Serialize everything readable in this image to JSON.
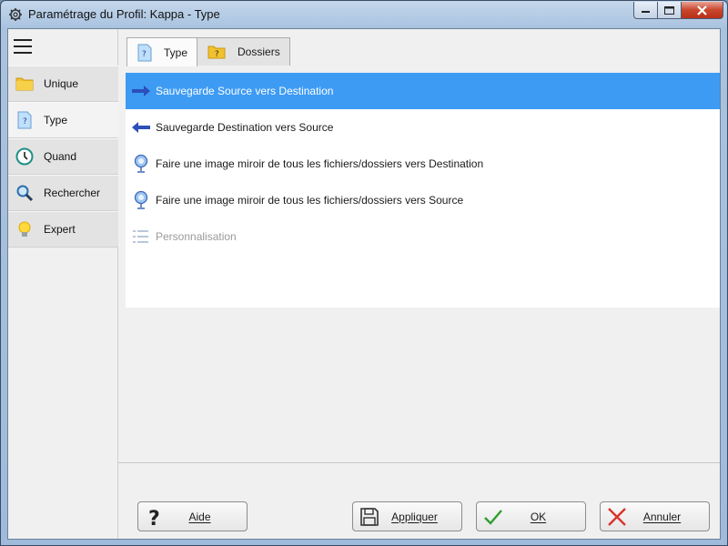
{
  "window": {
    "title": "Paramétrage du Profil: Kappa - Type",
    "controls": {
      "minimize": "▭",
      "maximize": "◻",
      "close": "✕"
    }
  },
  "sidebar": {
    "items": [
      {
        "label": "Unique",
        "icon": "folder-icon",
        "active": false
      },
      {
        "label": "Type",
        "icon": "question-file-icon",
        "active": true
      },
      {
        "label": "Quand",
        "icon": "clock-icon",
        "active": false
      },
      {
        "label": "Rechercher",
        "icon": "magnifier-icon",
        "active": false
      },
      {
        "label": "Expert",
        "icon": "lightbulb-icon",
        "active": false
      }
    ]
  },
  "tabs": [
    {
      "label": "Type",
      "icon": "question-file-icon",
      "active": true
    },
    {
      "label": "Dossiers",
      "icon": "question-folder-icon",
      "active": false
    }
  ],
  "options": [
    {
      "label": "Sauvegarde Source vers Destination",
      "icon": "arrow-right-icon",
      "selected": true,
      "enabled": true
    },
    {
      "label": "Sauvegarde Destination vers Source",
      "icon": "arrow-left-icon",
      "selected": false,
      "enabled": true
    },
    {
      "label": "Faire une image miroir de tous les fichiers/dossiers vers Destination",
      "icon": "mirror-icon",
      "selected": false,
      "enabled": true
    },
    {
      "label": "Faire une image miroir de tous les fichiers/dossiers vers Source",
      "icon": "mirror-icon",
      "selected": false,
      "enabled": true
    },
    {
      "label": "Personnalisation",
      "icon": "list-icon",
      "selected": false,
      "enabled": false
    }
  ],
  "buttons": {
    "help": "Aide",
    "apply": "Appliquer",
    "ok": "OK",
    "cancel": "Annuler"
  },
  "colors": {
    "selection": "#3d9bf4",
    "arrow": "#2c4fb8",
    "ok_check": "#2f9e2f",
    "cancel_x": "#d9342b"
  }
}
